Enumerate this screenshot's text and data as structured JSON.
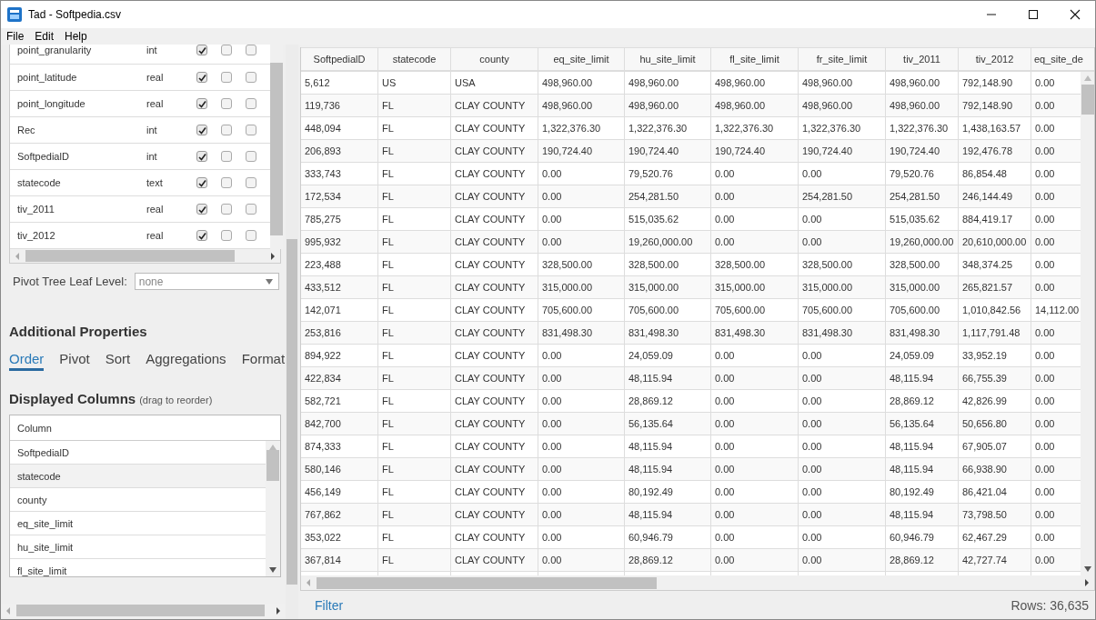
{
  "window": {
    "title": "Tad - Softpedia.csv"
  },
  "menu": [
    "File",
    "Edit",
    "Help"
  ],
  "column_list": {
    "rows": [
      {
        "name": "point_granularity",
        "type": "int",
        "checkboxes": [
          {
            "checked": true
          },
          {
            "checked": false
          },
          {
            "checked": false
          }
        ]
      },
      {
        "name": "point_latitude",
        "type": "real",
        "checkboxes": [
          {
            "checked": true
          },
          {
            "checked": false
          },
          {
            "checked": false
          }
        ]
      },
      {
        "name": "point_longitude",
        "type": "real",
        "checkboxes": [
          {
            "checked": true
          },
          {
            "checked": false
          },
          {
            "checked": false
          }
        ]
      },
      {
        "name": "Rec",
        "type": "int",
        "checkboxes": [
          {
            "checked": true
          },
          {
            "checked": false
          },
          {
            "checked": false
          }
        ]
      },
      {
        "name": "SoftpedialD",
        "type": "int",
        "checkboxes": [
          {
            "checked": true
          },
          {
            "checked": false
          },
          {
            "checked": false
          }
        ]
      },
      {
        "name": "statecode",
        "type": "text",
        "checkboxes": [
          {
            "checked": true
          },
          {
            "checked": false
          },
          {
            "checked": false
          }
        ]
      },
      {
        "name": "tiv_2011",
        "type": "real",
        "checkboxes": [
          {
            "checked": true
          },
          {
            "checked": false
          },
          {
            "checked": false
          }
        ]
      },
      {
        "name": "tiv_2012",
        "type": "real",
        "checkboxes": [
          {
            "checked": true
          },
          {
            "checked": false
          },
          {
            "checked": false
          }
        ]
      }
    ]
  },
  "pivot_leaf_level": {
    "label": "Pivot Tree Leaf Level:",
    "value": "none"
  },
  "additional_properties": {
    "title": "Additional Properties",
    "tabs": [
      {
        "label": "Order",
        "selected": true
      },
      {
        "label": "Pivot",
        "selected": false
      },
      {
        "label": "Sort",
        "selected": false
      },
      {
        "label": "Aggregations",
        "selected": false
      },
      {
        "label": "Format",
        "selected": false
      }
    ]
  },
  "displayed_columns": {
    "title": "Displayed Columns",
    "hint": "(drag to reorder)",
    "header": "Column",
    "rows": [
      {
        "label": "SoftpedialD",
        "selected": false
      },
      {
        "label": "statecode",
        "selected": true
      },
      {
        "label": "county",
        "selected": false
      },
      {
        "label": "eq_site_limit",
        "selected": false
      },
      {
        "label": "hu_site_limit",
        "selected": false
      },
      {
        "label": "fl_site_limit",
        "selected": false
      }
    ]
  },
  "grid": {
    "columns": [
      "SoftpedialD",
      "statecode",
      "county",
      "eq_site_limit",
      "hu_site_limit",
      "fl_site_limit",
      "fr_site_limit",
      "tiv_2011",
      "tiv_2012",
      "eq_site_de"
    ],
    "rows": [
      [
        "5,612",
        "US",
        "USA",
        "498,960.00",
        "498,960.00",
        "498,960.00",
        "498,960.00",
        "498,960.00",
        "792,148.90",
        "0.00"
      ],
      [
        "119,736",
        "FL",
        "CLAY COUNTY",
        "498,960.00",
        "498,960.00",
        "498,960.00",
        "498,960.00",
        "498,960.00",
        "792,148.90",
        "0.00"
      ],
      [
        "448,094",
        "FL",
        "CLAY COUNTY",
        "1,322,376.30",
        "1,322,376.30",
        "1,322,376.30",
        "1,322,376.30",
        "1,322,376.30",
        "1,438,163.57",
        "0.00"
      ],
      [
        "206,893",
        "FL",
        "CLAY COUNTY",
        "190,724.40",
        "190,724.40",
        "190,724.40",
        "190,724.40",
        "190,724.40",
        "192,476.78",
        "0.00"
      ],
      [
        "333,743",
        "FL",
        "CLAY COUNTY",
        "0.00",
        "79,520.76",
        "0.00",
        "0.00",
        "79,520.76",
        "86,854.48",
        "0.00"
      ],
      [
        "172,534",
        "FL",
        "CLAY COUNTY",
        "0.00",
        "254,281.50",
        "0.00",
        "254,281.50",
        "254,281.50",
        "246,144.49",
        "0.00"
      ],
      [
        "785,275",
        "FL",
        "CLAY COUNTY",
        "0.00",
        "515,035.62",
        "0.00",
        "0.00",
        "515,035.62",
        "884,419.17",
        "0.00"
      ],
      [
        "995,932",
        "FL",
        "CLAY COUNTY",
        "0.00",
        "19,260,000.00",
        "0.00",
        "0.00",
        "19,260,000.00",
        "20,610,000.00",
        "0.00"
      ],
      [
        "223,488",
        "FL",
        "CLAY COUNTY",
        "328,500.00",
        "328,500.00",
        "328,500.00",
        "328,500.00",
        "328,500.00",
        "348,374.25",
        "0.00"
      ],
      [
        "433,512",
        "FL",
        "CLAY COUNTY",
        "315,000.00",
        "315,000.00",
        "315,000.00",
        "315,000.00",
        "315,000.00",
        "265,821.57",
        "0.00"
      ],
      [
        "142,071",
        "FL",
        "CLAY COUNTY",
        "705,600.00",
        "705,600.00",
        "705,600.00",
        "705,600.00",
        "705,600.00",
        "1,010,842.56",
        "14,112.00"
      ],
      [
        "253,816",
        "FL",
        "CLAY COUNTY",
        "831,498.30",
        "831,498.30",
        "831,498.30",
        "831,498.30",
        "831,498.30",
        "1,117,791.48",
        "0.00"
      ],
      [
        "894,922",
        "FL",
        "CLAY COUNTY",
        "0.00",
        "24,059.09",
        "0.00",
        "0.00",
        "24,059.09",
        "33,952.19",
        "0.00"
      ],
      [
        "422,834",
        "FL",
        "CLAY COUNTY",
        "0.00",
        "48,115.94",
        "0.00",
        "0.00",
        "48,115.94",
        "66,755.39",
        "0.00"
      ],
      [
        "582,721",
        "FL",
        "CLAY COUNTY",
        "0.00",
        "28,869.12",
        "0.00",
        "0.00",
        "28,869.12",
        "42,826.99",
        "0.00"
      ],
      [
        "842,700",
        "FL",
        "CLAY COUNTY",
        "0.00",
        "56,135.64",
        "0.00",
        "0.00",
        "56,135.64",
        "50,656.80",
        "0.00"
      ],
      [
        "874,333",
        "FL",
        "CLAY COUNTY",
        "0.00",
        "48,115.94",
        "0.00",
        "0.00",
        "48,115.94",
        "67,905.07",
        "0.00"
      ],
      [
        "580,146",
        "FL",
        "CLAY COUNTY",
        "0.00",
        "48,115.94",
        "0.00",
        "0.00",
        "48,115.94",
        "66,938.90",
        "0.00"
      ],
      [
        "456,149",
        "FL",
        "CLAY COUNTY",
        "0.00",
        "80,192.49",
        "0.00",
        "0.00",
        "80,192.49",
        "86,421.04",
        "0.00"
      ],
      [
        "767,862",
        "FL",
        "CLAY COUNTY",
        "0.00",
        "48,115.94",
        "0.00",
        "0.00",
        "48,115.94",
        "73,798.50",
        "0.00"
      ],
      [
        "353,022",
        "FL",
        "CLAY COUNTY",
        "0.00",
        "60,946.79",
        "0.00",
        "0.00",
        "60,946.79",
        "62,467.29",
        "0.00"
      ],
      [
        "367,814",
        "FL",
        "CLAY COUNTY",
        "0.00",
        "28,869.12",
        "0.00",
        "0.00",
        "28,869.12",
        "42,727.74",
        "0.00"
      ]
    ]
  },
  "footer": {
    "filter": "Filter",
    "row_count": "Rows: 36,635"
  }
}
